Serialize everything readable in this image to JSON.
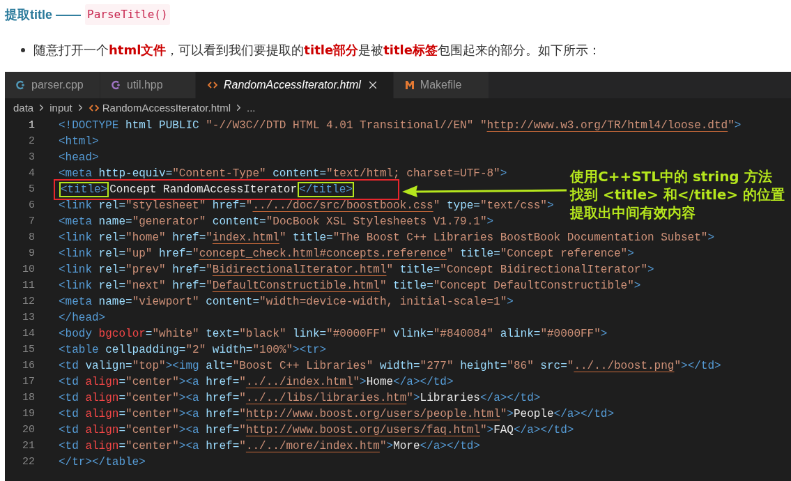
{
  "heading": {
    "text": "提取title ——",
    "code": "ParseTitle()"
  },
  "bullet": "随意打开一个**html文件**，可以看到我们要提取的**title部分**是被**title标签**包围起来的部分。如下所示：",
  "editor": {
    "tabs": [
      {
        "label": "parser.cpp",
        "kind": "cpp",
        "selected": false
      },
      {
        "label": "util.hpp",
        "kind": "hpp",
        "selected": false
      },
      {
        "label": "RandomAccessIterator.html",
        "kind": "html",
        "selected": true
      },
      {
        "label": "Makefile",
        "kind": "makefile",
        "selected": false
      }
    ],
    "breadcrumb": [
      {
        "label": "data",
        "kind": "folder"
      },
      {
        "label": "input",
        "kind": "folder"
      },
      {
        "label": "RandomAccessIterator.html",
        "kind": "html"
      },
      {
        "label": "...",
        "kind": "more"
      }
    ],
    "lines": [
      {
        "number": "1",
        "current": true,
        "highlight": false,
        "tokens": [
          {
            "kind": "tag",
            "text": "<!DOCTYPE"
          },
          {
            "kind": "attr",
            "text": " html PUBLIC "
          },
          {
            "kind": "string",
            "text": "\"-//W3C//DTD HTML 4.01 Transitional//EN\" \""
          },
          {
            "kind": "link",
            "text": "http://www.w3.org/TR/html4/loose.dtd"
          },
          {
            "kind": "string",
            "text": "\""
          },
          {
            "kind": "tag",
            "text": ">"
          }
        ]
      },
      {
        "number": "2",
        "current": false,
        "highlight": false,
        "tokens": [
          {
            "kind": "tag",
            "text": "<html>"
          }
        ]
      },
      {
        "number": "3",
        "current": false,
        "highlight": false,
        "tokens": [
          {
            "kind": "tag",
            "text": "<head>"
          }
        ]
      },
      {
        "number": "4",
        "current": false,
        "highlight": false,
        "tokens": [
          {
            "kind": "tag",
            "text": "<meta"
          },
          {
            "kind": "attr",
            "text": " http-equiv="
          },
          {
            "kind": "string",
            "text": "\"Content-Type\""
          },
          {
            "kind": "attr",
            "text": " content="
          },
          {
            "kind": "string",
            "text": "\"text/html; charset=UTF-8\""
          },
          {
            "kind": "tag",
            "text": ">"
          }
        ]
      },
      {
        "number": "5",
        "current": false,
        "highlight": true,
        "tokens": [
          {
            "kind": "tag",
            "text": "<title>",
            "boxed": true
          },
          {
            "kind": "text",
            "text": "Concept RandomAccessIterator"
          },
          {
            "kind": "tag",
            "text": "</title>",
            "boxed": true
          }
        ]
      },
      {
        "number": "6",
        "current": false,
        "highlight": false,
        "tokens": [
          {
            "kind": "tag",
            "text": "<link"
          },
          {
            "kind": "attr",
            "text": " rel="
          },
          {
            "kind": "string",
            "text": "\"stylesheet\""
          },
          {
            "kind": "attr",
            "text": " href="
          },
          {
            "kind": "string",
            "text": "\""
          },
          {
            "kind": "link",
            "text": "../../doc/src/boostbook.css"
          },
          {
            "kind": "string",
            "text": "\""
          },
          {
            "kind": "attr",
            "text": " type="
          },
          {
            "kind": "string",
            "text": "\"text/css\""
          },
          {
            "kind": "tag",
            "text": ">"
          }
        ]
      },
      {
        "number": "7",
        "current": false,
        "highlight": false,
        "tokens": [
          {
            "kind": "tag",
            "text": "<meta"
          },
          {
            "kind": "attr",
            "text": " name="
          },
          {
            "kind": "string",
            "text": "\"generator\""
          },
          {
            "kind": "attr",
            "text": " content="
          },
          {
            "kind": "string",
            "text": "\"DocBook XSL Stylesheets V1.79.1\""
          },
          {
            "kind": "tag",
            "text": ">"
          }
        ]
      },
      {
        "number": "8",
        "current": false,
        "highlight": false,
        "tokens": [
          {
            "kind": "tag",
            "text": "<link"
          },
          {
            "kind": "attr",
            "text": " rel="
          },
          {
            "kind": "string",
            "text": "\"home\""
          },
          {
            "kind": "attr",
            "text": " href="
          },
          {
            "kind": "string",
            "text": "\""
          },
          {
            "kind": "link",
            "text": "index.html"
          },
          {
            "kind": "string",
            "text": "\""
          },
          {
            "kind": "attr",
            "text": " title="
          },
          {
            "kind": "string",
            "text": "\"The Boost C++ Libraries BoostBook Documentation Subset\""
          },
          {
            "kind": "tag",
            "text": ">"
          }
        ]
      },
      {
        "number": "9",
        "current": false,
        "highlight": false,
        "tokens": [
          {
            "kind": "tag",
            "text": "<link"
          },
          {
            "kind": "attr",
            "text": " rel="
          },
          {
            "kind": "string",
            "text": "\"up\""
          },
          {
            "kind": "attr",
            "text": " href="
          },
          {
            "kind": "string",
            "text": "\""
          },
          {
            "kind": "link",
            "text": "concept_check.html#concepts.reference"
          },
          {
            "kind": "string",
            "text": "\""
          },
          {
            "kind": "attr",
            "text": " title="
          },
          {
            "kind": "string",
            "text": "\"Concept reference\""
          },
          {
            "kind": "tag",
            "text": ">"
          }
        ]
      },
      {
        "number": "10",
        "current": false,
        "highlight": false,
        "tokens": [
          {
            "kind": "tag",
            "text": "<link"
          },
          {
            "kind": "attr",
            "text": " rel="
          },
          {
            "kind": "string",
            "text": "\"prev\""
          },
          {
            "kind": "attr",
            "text": " href="
          },
          {
            "kind": "string",
            "text": "\""
          },
          {
            "kind": "link",
            "text": "BidirectionalIterator.html"
          },
          {
            "kind": "string",
            "text": "\""
          },
          {
            "kind": "attr",
            "text": " title="
          },
          {
            "kind": "string",
            "text": "\"Concept BidirectionalIterator\""
          },
          {
            "kind": "tag",
            "text": ">"
          }
        ]
      },
      {
        "number": "11",
        "current": false,
        "highlight": false,
        "tokens": [
          {
            "kind": "tag",
            "text": "<link"
          },
          {
            "kind": "attr",
            "text": " rel="
          },
          {
            "kind": "string",
            "text": "\"next\""
          },
          {
            "kind": "attr",
            "text": " href="
          },
          {
            "kind": "string",
            "text": "\""
          },
          {
            "kind": "link",
            "text": "DefaultConstructible.html"
          },
          {
            "kind": "string",
            "text": "\""
          },
          {
            "kind": "attr",
            "text": " title="
          },
          {
            "kind": "string",
            "text": "\"Concept DefaultConstructible\""
          },
          {
            "kind": "tag",
            "text": ">"
          }
        ]
      },
      {
        "number": "12",
        "current": false,
        "highlight": false,
        "tokens": [
          {
            "kind": "tag",
            "text": "<meta"
          },
          {
            "kind": "attr",
            "text": " name="
          },
          {
            "kind": "string",
            "text": "\"viewport\""
          },
          {
            "kind": "attr",
            "text": " content="
          },
          {
            "kind": "string",
            "text": "\"width=device-width, initial-scale=1\""
          },
          {
            "kind": "tag",
            "text": ">"
          }
        ]
      },
      {
        "number": "13",
        "current": false,
        "highlight": false,
        "tokens": [
          {
            "kind": "tag",
            "text": "</head>"
          }
        ]
      },
      {
        "number": "14",
        "current": false,
        "highlight": false,
        "tokens": [
          {
            "kind": "tag",
            "text": "<body"
          },
          {
            "kind": "alert",
            "text": " bgcolor"
          },
          {
            "kind": "attr",
            "text": "="
          },
          {
            "kind": "string",
            "text": "\"white\""
          },
          {
            "kind": "attr",
            "text": " text="
          },
          {
            "kind": "string",
            "text": "\"black\""
          },
          {
            "kind": "attr",
            "text": " link="
          },
          {
            "kind": "string",
            "text": "\"#0000FF\""
          },
          {
            "kind": "attr",
            "text": " vlink="
          },
          {
            "kind": "string",
            "text": "\"#840084\""
          },
          {
            "kind": "attr",
            "text": " alink="
          },
          {
            "kind": "string",
            "text": "\"#0000FF\""
          },
          {
            "kind": "tag",
            "text": ">"
          }
        ]
      },
      {
        "number": "15",
        "current": false,
        "highlight": false,
        "tokens": [
          {
            "kind": "tag",
            "text": "<table"
          },
          {
            "kind": "attr",
            "text": " cellpadding="
          },
          {
            "kind": "string",
            "text": "\"2\""
          },
          {
            "kind": "attr",
            "text": " width="
          },
          {
            "kind": "string",
            "text": "\"100%\""
          },
          {
            "kind": "tag",
            "text": "><tr>"
          }
        ]
      },
      {
        "number": "16",
        "current": false,
        "highlight": false,
        "tokens": [
          {
            "kind": "tag",
            "text": "<td"
          },
          {
            "kind": "attr",
            "text": " valign="
          },
          {
            "kind": "string",
            "text": "\"top\""
          },
          {
            "kind": "tag",
            "text": "><img"
          },
          {
            "kind": "attr",
            "text": " alt="
          },
          {
            "kind": "string",
            "text": "\"Boost C++ Libraries\""
          },
          {
            "kind": "attr",
            "text": " width="
          },
          {
            "kind": "string",
            "text": "\"277\""
          },
          {
            "kind": "attr",
            "text": " height="
          },
          {
            "kind": "string",
            "text": "\"86\""
          },
          {
            "kind": "attr",
            "text": " src="
          },
          {
            "kind": "string",
            "text": "\""
          },
          {
            "kind": "link",
            "text": "../../boost.png"
          },
          {
            "kind": "string",
            "text": "\""
          },
          {
            "kind": "tag",
            "text": "></td>"
          }
        ]
      },
      {
        "number": "17",
        "current": false,
        "highlight": false,
        "tokens": [
          {
            "kind": "tag",
            "text": "<td"
          },
          {
            "kind": "alert",
            "text": " align"
          },
          {
            "kind": "attr",
            "text": "="
          },
          {
            "kind": "string",
            "text": "\"center\""
          },
          {
            "kind": "tag",
            "text": "><a"
          },
          {
            "kind": "attr",
            "text": " href="
          },
          {
            "kind": "string",
            "text": "\""
          },
          {
            "kind": "link",
            "text": "../../index.html"
          },
          {
            "kind": "string",
            "text": "\""
          },
          {
            "kind": "tag",
            "text": ">"
          },
          {
            "kind": "text",
            "text": "Home"
          },
          {
            "kind": "tag",
            "text": "</a></td>"
          }
        ]
      },
      {
        "number": "18",
        "current": false,
        "highlight": false,
        "tokens": [
          {
            "kind": "tag",
            "text": "<td"
          },
          {
            "kind": "alert",
            "text": " align"
          },
          {
            "kind": "attr",
            "text": "="
          },
          {
            "kind": "string",
            "text": "\"center\""
          },
          {
            "kind": "tag",
            "text": "><a"
          },
          {
            "kind": "attr",
            "text": " href="
          },
          {
            "kind": "string",
            "text": "\""
          },
          {
            "kind": "link",
            "text": "../../libs/libraries.htm"
          },
          {
            "kind": "string",
            "text": "\""
          },
          {
            "kind": "tag",
            "text": ">"
          },
          {
            "kind": "text",
            "text": "Libraries"
          },
          {
            "kind": "tag",
            "text": "</a></td>"
          }
        ]
      },
      {
        "number": "19",
        "current": false,
        "highlight": false,
        "tokens": [
          {
            "kind": "tag",
            "text": "<td"
          },
          {
            "kind": "alert",
            "text": " align"
          },
          {
            "kind": "attr",
            "text": "="
          },
          {
            "kind": "string",
            "text": "\"center\""
          },
          {
            "kind": "tag",
            "text": "><a"
          },
          {
            "kind": "attr",
            "text": " href="
          },
          {
            "kind": "string",
            "text": "\""
          },
          {
            "kind": "link",
            "text": "http://www.boost.org/users/people.html"
          },
          {
            "kind": "string",
            "text": "\""
          },
          {
            "kind": "tag",
            "text": ">"
          },
          {
            "kind": "text",
            "text": "People"
          },
          {
            "kind": "tag",
            "text": "</a></td>"
          }
        ]
      },
      {
        "number": "20",
        "current": false,
        "highlight": false,
        "tokens": [
          {
            "kind": "tag",
            "text": "<td"
          },
          {
            "kind": "alert",
            "text": " align"
          },
          {
            "kind": "attr",
            "text": "="
          },
          {
            "kind": "string",
            "text": "\"center\""
          },
          {
            "kind": "tag",
            "text": "><a"
          },
          {
            "kind": "attr",
            "text": " href="
          },
          {
            "kind": "string",
            "text": "\""
          },
          {
            "kind": "link",
            "text": "http://www.boost.org/users/faq.html"
          },
          {
            "kind": "string",
            "text": "\""
          },
          {
            "kind": "tag",
            "text": ">"
          },
          {
            "kind": "text",
            "text": "FAQ"
          },
          {
            "kind": "tag",
            "text": "</a></td>"
          }
        ]
      },
      {
        "number": "21",
        "current": false,
        "highlight": false,
        "tokens": [
          {
            "kind": "tag",
            "text": "<td"
          },
          {
            "kind": "alert",
            "text": " align"
          },
          {
            "kind": "attr",
            "text": "="
          },
          {
            "kind": "string",
            "text": "\"center\""
          },
          {
            "kind": "tag",
            "text": "><a"
          },
          {
            "kind": "attr",
            "text": " href="
          },
          {
            "kind": "string",
            "text": "\""
          },
          {
            "kind": "link",
            "text": "../../more/index.htm"
          },
          {
            "kind": "string",
            "text": "\""
          },
          {
            "kind": "tag",
            "text": ">"
          },
          {
            "kind": "text",
            "text": "More"
          },
          {
            "kind": "tag",
            "text": "</a></td>"
          }
        ]
      },
      {
        "number": "22",
        "current": false,
        "highlight": false,
        "tokens": [
          {
            "kind": "tag",
            "text": "</tr></table>"
          }
        ]
      }
    ],
    "annotation": [
      "使用C++STL中的 string 方法",
      "找到 <title> 和</title> 的位置",
      "提取出中间有效内容"
    ]
  }
}
